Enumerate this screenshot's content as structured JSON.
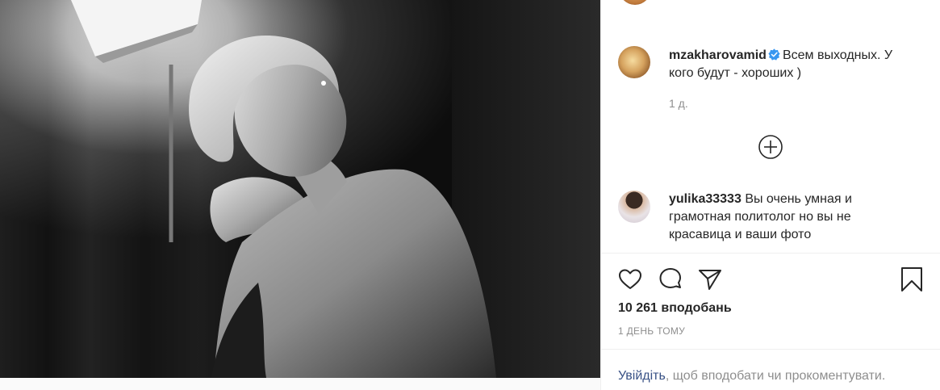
{
  "post": {
    "image_alt": "Black and white portrait of a woman with short light hair, eyes closed, hand behind her head"
  },
  "caption": {
    "username": "mzakharovamid",
    "verified": true,
    "text": "Всем выходных. У кого будут - хороших )",
    "time": "1 д."
  },
  "comments": [
    {
      "username": "yulika33333",
      "text": "Вы очень умная и грамотная политолог но вы не красавица и ваши фото"
    }
  ],
  "icons": {
    "more_comments": "plus-circle-icon",
    "like": "heart-icon",
    "comment": "comment-bubble-icon",
    "share": "paper-plane-icon",
    "save": "bookmark-icon",
    "verified": "verified-badge-icon"
  },
  "stats": {
    "likes": "10 261 вподобань",
    "date": "1 ДЕНЬ ТОМУ"
  },
  "login_prompt": {
    "link": "Увійдіть",
    "text": ", щоб вподобати чи прокоментувати."
  },
  "colors": {
    "text": "#262626",
    "secondary": "#8e8e8e",
    "link": "#385185",
    "verified": "#3897f0",
    "divider": "#efefef"
  }
}
